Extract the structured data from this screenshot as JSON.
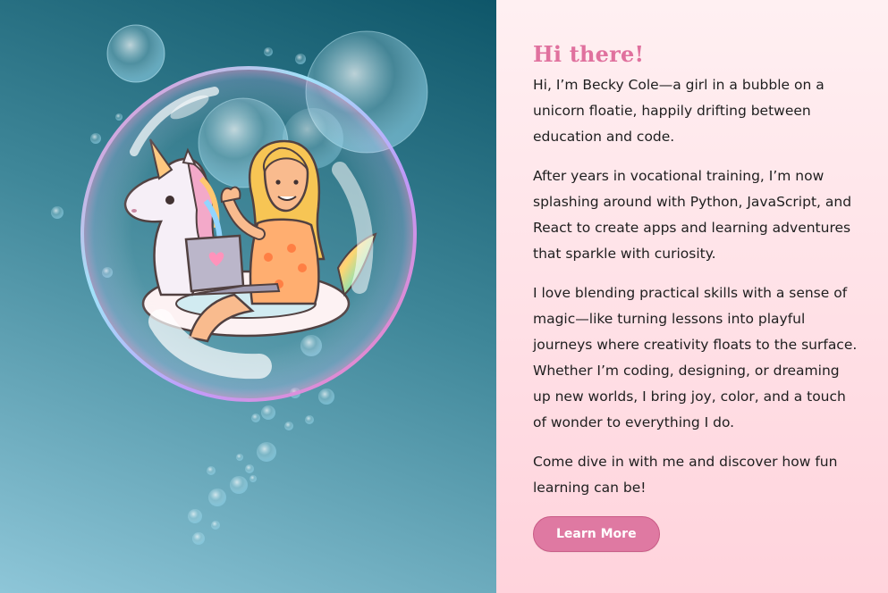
{
  "hero": {
    "title": "Hi there!",
    "paragraphs": [
      "Hi, I’m Becky Cole—a girl in a bubble on a unicorn floatie, happily drifting between education and code.",
      "After years in vocational training, I’m now splashing around with Python, JavaScript, and React to create apps and learning adventures that sparkle with curiosity.",
      "I love blending practical skills with a sense of magic—like turning lessons into playful journeys where creativity floats to the surface. Whether I’m coding, designing, or dreaming up new worlds, I bring joy, color, and a touch of wonder to everything I do.",
      "Come dive in with me and discover how fun learning can be!"
    ],
    "cta_label": "Learn More"
  },
  "illustration": {
    "icon": "girl-on-unicorn-floatie-in-bubble-illustration",
    "colors": {
      "background_top": "#0e5669",
      "background_bottom": "#8ec6d8",
      "accent_pink": "#e0719e",
      "button": "#df79a2"
    }
  }
}
